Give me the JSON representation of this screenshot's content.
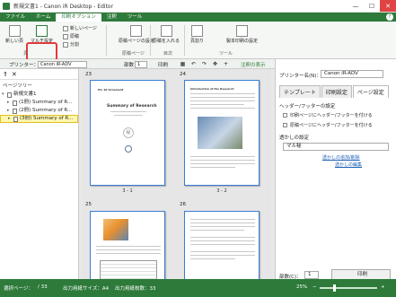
{
  "window": {
    "title": "新規文書1 - Canon iR Desktop - Editor",
    "minimize": "—",
    "maximize": "☐",
    "close": "✕"
  },
  "menu": {
    "tabs": [
      "ファイル",
      "ホーム",
      "印刷オプション",
      "注釈",
      "ツール"
    ],
    "active_tab": "印刷オプション",
    "help": "?"
  },
  "ribbon": {
    "new_page": "新しい頁",
    "new_page_dropdown": "マルチ設定",
    "new_page_sub": "新しいページ",
    "insert": "原稿",
    "split": "分割",
    "page_settings": "原稿ページの設定",
    "insert_page": "原稿を入れる",
    "bind": "頁割り",
    "binding": "製本印刷の設定",
    "group_labels": [
      "頁",
      "原稿ページ",
      "目次",
      "ツール"
    ]
  },
  "toolbar": {
    "printer_label": "プリンター：",
    "printer_value": "Canon iR-ADV",
    "copies_label": "部数",
    "copies_value": "1",
    "print_label": "印刷",
    "view_label": "注釈の表示"
  },
  "sidebar": {
    "title": "ページツリー",
    "items": [
      {
        "label": "新規文書1",
        "level": 0,
        "selected": false
      },
      {
        "label": "(1冊) Summary of R...",
        "level": 1,
        "selected": false
      },
      {
        "label": "(2冊) Summary of R...",
        "level": 1,
        "selected": false
      },
      {
        "label": "(3冊) Summary of R...",
        "level": 1,
        "selected": true
      }
    ]
  },
  "pages": [
    {
      "number": "23",
      "label": "3 - 1",
      "heading": "Summary of Research"
    },
    {
      "number": "24",
      "label": "3 - 2",
      "heading": "Introduction of the Research"
    },
    {
      "number": "25",
      "label": "3 - 3",
      "heading": ""
    },
    {
      "number": "26",
      "label": "3 - 4",
      "heading": ""
    }
  ],
  "panel": {
    "printer_label": "プリンター名(N)：",
    "printer_value": "Canon iR-ADV",
    "tabs": [
      "テンプレート",
      "印刷設定",
      "ページ設定"
    ],
    "active_tab": "ページ設定",
    "section": "ヘッダー/フッターの設定",
    "check1": "印刷ページにヘッダー/フッターを付ける",
    "check2": "原稿ページにヘッダー/フッターを付ける",
    "watermark_label": "透かしの設定",
    "watermark_value": "マル秘",
    "link_add": "透かしの追加/削除",
    "link_edit": "透かしの編集",
    "copies_label": "部数(C)：",
    "copies_value": "1",
    "print_button": "印刷"
  },
  "status": {
    "selected_page": "選択ページ：",
    "selected_value": "/ 33",
    "paper": "出力用紙サイズ：A4",
    "pages": "出力用紙枚数：33",
    "zoom": "25%",
    "zoom_fraction": 0.25
  },
  "colors": {
    "accent": "#2d7a3a",
    "highlight": "#e23a3a",
    "selection": "#fff7b0"
  }
}
